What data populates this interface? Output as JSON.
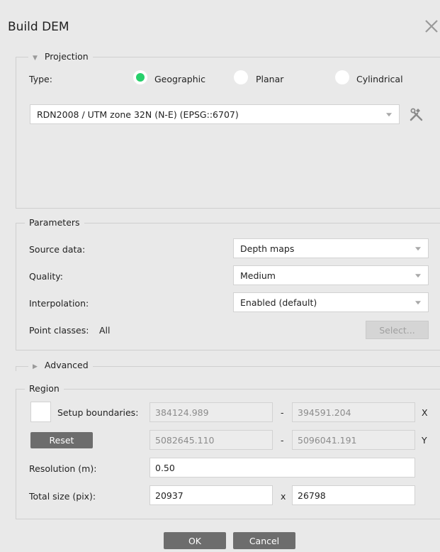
{
  "dialog": {
    "title": "Build DEM"
  },
  "projection": {
    "legend": "Projection",
    "type_label": "Type:",
    "options": [
      "Geographic",
      "Planar",
      "Cylindrical"
    ],
    "selected": "Geographic",
    "crs": "RDN2008 / UTM zone 32N (N-E) (EPSG::6707)"
  },
  "parameters": {
    "legend": "Parameters",
    "source_label": "Source data:",
    "source_value": "Depth maps",
    "quality_label": "Quality:",
    "quality_value": "Medium",
    "interpolation_label": "Interpolation:",
    "interpolation_value": "Enabled (default)",
    "point_classes_label": "Point classes:",
    "point_classes_value": "All",
    "select_label": "Select..."
  },
  "advanced": {
    "legend": "Advanced"
  },
  "region": {
    "legend": "Region",
    "setup_boundaries_label": "Setup boundaries:",
    "reset_label": "Reset",
    "x_min": "384124.989",
    "x_max": "394591.204",
    "y_min": "5082645.110",
    "y_max": "5096041.191",
    "dash": "-",
    "x_axis": "X",
    "y_axis": "Y",
    "resolution_label": "Resolution (m):",
    "resolution_value": "0.50",
    "total_size_label": "Total size (pix):",
    "size_w": "20937",
    "size_times": "x",
    "size_h": "26798"
  },
  "buttons": {
    "ok": "OK",
    "cancel": "Cancel"
  },
  "colors": {
    "accent_green": "#27d06b",
    "background": "#e9e9e9",
    "dark_button": "#6d6d6d"
  }
}
